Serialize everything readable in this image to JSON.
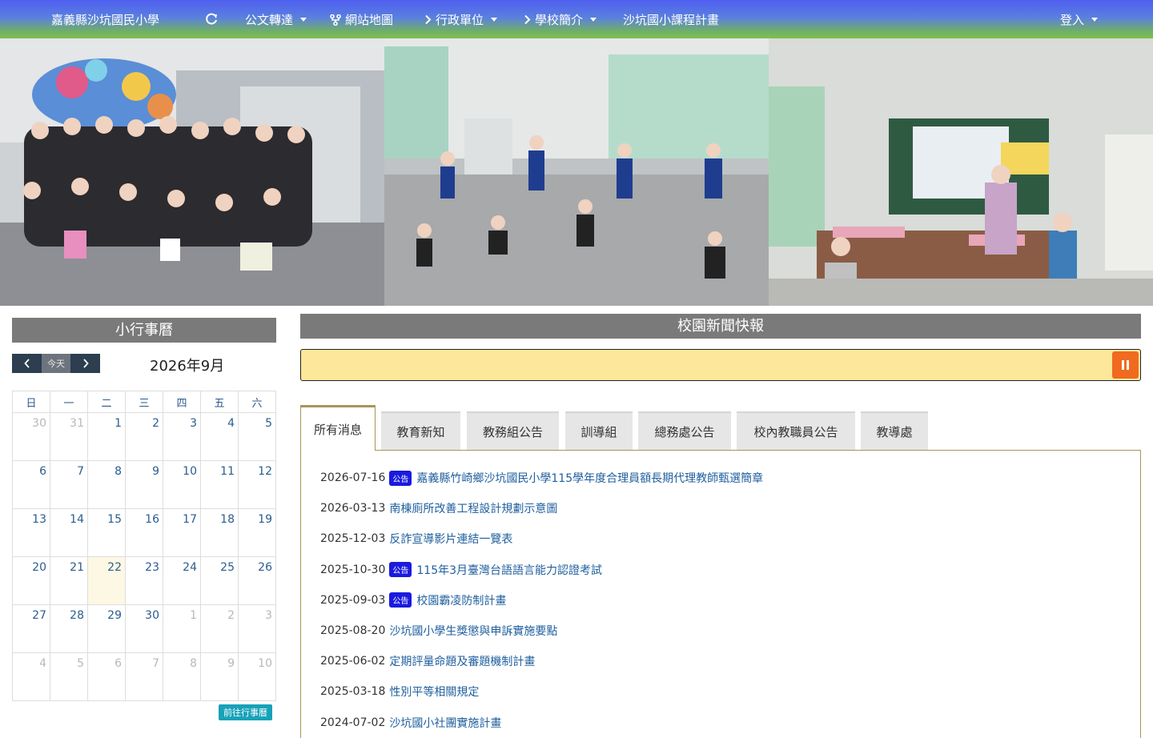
{
  "nav": {
    "brand": "嘉義縣沙坑國民小學",
    "items": [
      {
        "label": "公文轉達",
        "dropdown": true
      },
      {
        "label": "網站地圖",
        "icon": "sitemap-icon"
      },
      {
        "label": "行政單位",
        "icon": "chevron-right-icon",
        "dropdown": true
      },
      {
        "label": "學校簡介",
        "icon": "chevron-right-icon",
        "dropdown": true
      },
      {
        "label": "沙坑國小課程計畫"
      }
    ],
    "login": "登入"
  },
  "calendar": {
    "title": "小行事曆",
    "today_label": "今天",
    "month_label": "2026年9月",
    "weekdays": [
      "日",
      "一",
      "二",
      "三",
      "四",
      "五",
      "六"
    ],
    "weeks": [
      [
        "30",
        "31",
        "1",
        "2",
        "3",
        "4",
        "5"
      ],
      [
        "6",
        "7",
        "8",
        "9",
        "10",
        "11",
        "12"
      ],
      [
        "13",
        "14",
        "15",
        "16",
        "17",
        "18",
        "19"
      ],
      [
        "20",
        "21",
        "22",
        "23",
        "24",
        "25",
        "26"
      ],
      [
        "27",
        "28",
        "29",
        "30",
        "1",
        "2",
        "3"
      ],
      [
        "4",
        "5",
        "6",
        "7",
        "8",
        "9",
        "10"
      ]
    ],
    "today_day": "22",
    "goto_label": "前往行事曆"
  },
  "news": {
    "title": "校園新聞快報",
    "tabs": [
      "所有消息",
      "教育新知",
      "教務組公告",
      "訓導組",
      "總務處公告",
      "校內教職員公告",
      "教導處"
    ],
    "active_tab": 0,
    "badge_label": "公告",
    "items": [
      {
        "date": "2026-07-16",
        "badge": true,
        "title": "嘉義縣竹崎鄉沙坑國民小學115學年度合理員額長期代理教師甄選簡章"
      },
      {
        "date": "2026-03-13",
        "badge": false,
        "title": "南棟廁所改善工程設計規劃示意圖"
      },
      {
        "date": "2025-12-03",
        "badge": false,
        "title": "反詐宣導影片連結一覽表"
      },
      {
        "date": "2025-10-30",
        "badge": true,
        "title": "115年3月臺灣台語語言能力認證考試"
      },
      {
        "date": "2025-09-03",
        "badge": true,
        "title": "校園霸凌防制計畫"
      },
      {
        "date": "2025-08-20",
        "badge": false,
        "title": "沙坑國小學生獎懲與申訴實施要點"
      },
      {
        "date": "2025-06-02",
        "badge": false,
        "title": "定期評量命題及審題機制計畫"
      },
      {
        "date": "2025-03-18",
        "badge": false,
        "title": "性別平等相關規定"
      },
      {
        "date": "2024-07-02",
        "badge": false,
        "title": "沙坑國小社團實施計畫"
      }
    ]
  },
  "colors": {
    "nav_gradient_top": "#4f5ff0",
    "nav_gradient_bottom": "#7fc04c",
    "section_header": "#7a7a7a",
    "marquee_bg": "#fde79a",
    "pause_button": "#f06a1f",
    "badge": "#1a1ae0",
    "link": "#1f5f9e"
  }
}
